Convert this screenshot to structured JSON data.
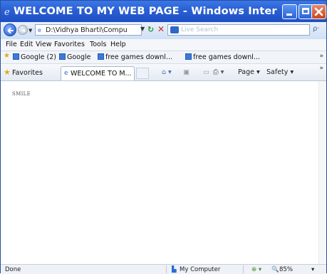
{
  "window": {
    "title": "WELCOME TO MY WEB PAGE - Windows Internet Expl..."
  },
  "address": {
    "url": "D:\\Vidhya Bharti\\Compu",
    "search_placeholder": "Live Search"
  },
  "menu": {
    "items": [
      "File",
      "Edit",
      "View",
      "Favorites",
      "Tools",
      "Help"
    ]
  },
  "links": {
    "items": [
      "Google (2)",
      "Google",
      "free games downl...",
      "free games downl..."
    ]
  },
  "favorites_bar": {
    "favorites_label": "Favorites",
    "tab_title": "WELCOME TO M...",
    "page_label": "Page",
    "safety_label": "Safety"
  },
  "content": {
    "text": "SMILE"
  },
  "status": {
    "left": "Done",
    "zone": "My Computer",
    "zoom": "85%"
  },
  "colors": {
    "titlebar": "#2a5fd2",
    "close_button": "#c9461c"
  }
}
